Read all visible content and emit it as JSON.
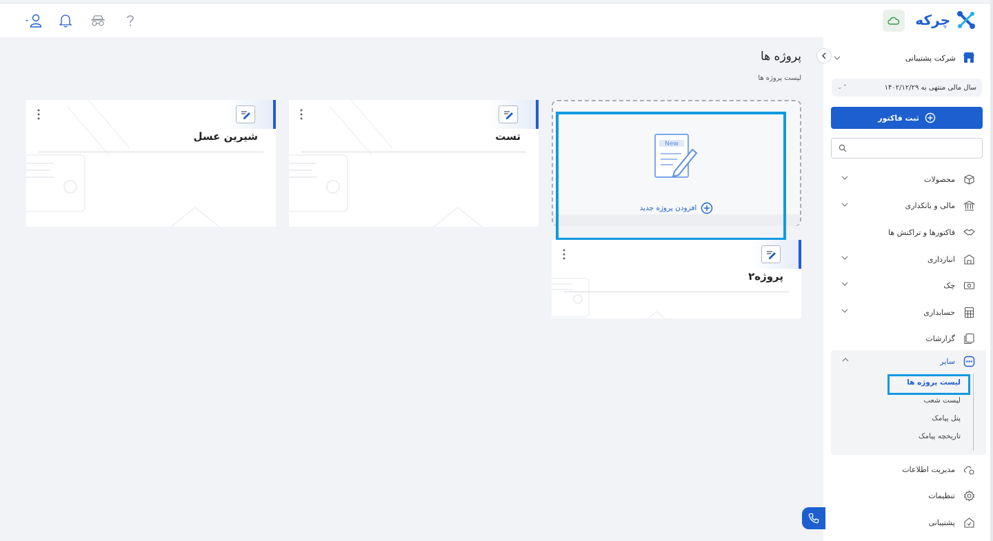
{
  "app": {
    "logo_text": "چرکه"
  },
  "sidebar": {
    "company": "شرکت پشتیبانی",
    "fiscal_year": "سال مالی منتهی به ۱۴۰۲/۱۲/۲۹",
    "add_invoice_label": "ثبت فاکتور",
    "search_placeholder": "",
    "items": [
      {
        "label": "محصولات",
        "icon": "box-icon"
      },
      {
        "label": "مالی و بانکداری",
        "icon": "bank-icon"
      },
      {
        "label": "فاکتورها و تراکنش ها",
        "icon": "handshake-icon"
      },
      {
        "label": "انبارداری",
        "icon": "warehouse-icon"
      },
      {
        "label": "چک",
        "icon": "cheque-icon"
      },
      {
        "label": "حسابداری",
        "icon": "calculator-icon"
      },
      {
        "label": "گزارشات",
        "icon": "report-icon"
      }
    ],
    "other": {
      "label": "سایر",
      "subitems": [
        "لیست پروژه ها",
        "لیست شعب",
        "پنل پیامک",
        "تاریخچه پیامک"
      ]
    },
    "bottom_items": [
      {
        "label": "مدیریت اطلاعات",
        "icon": "cloud-gear-icon"
      },
      {
        "label": "تنظیمات",
        "icon": "gear-icon"
      },
      {
        "label": "پشتیبانی",
        "icon": "support-icon"
      }
    ]
  },
  "main": {
    "title": "پروژه ها",
    "breadcrumb": "لیست پروژه ها",
    "new_project_label": "افزودن پروژه جدید",
    "new_badge": "New",
    "projects": [
      {
        "name": "پروژه۲"
      },
      {
        "name": "تست"
      },
      {
        "name": "شیرین عسل"
      }
    ]
  },
  "colors": {
    "primary": "#1d5fcf",
    "highlight": "#1199e0"
  }
}
